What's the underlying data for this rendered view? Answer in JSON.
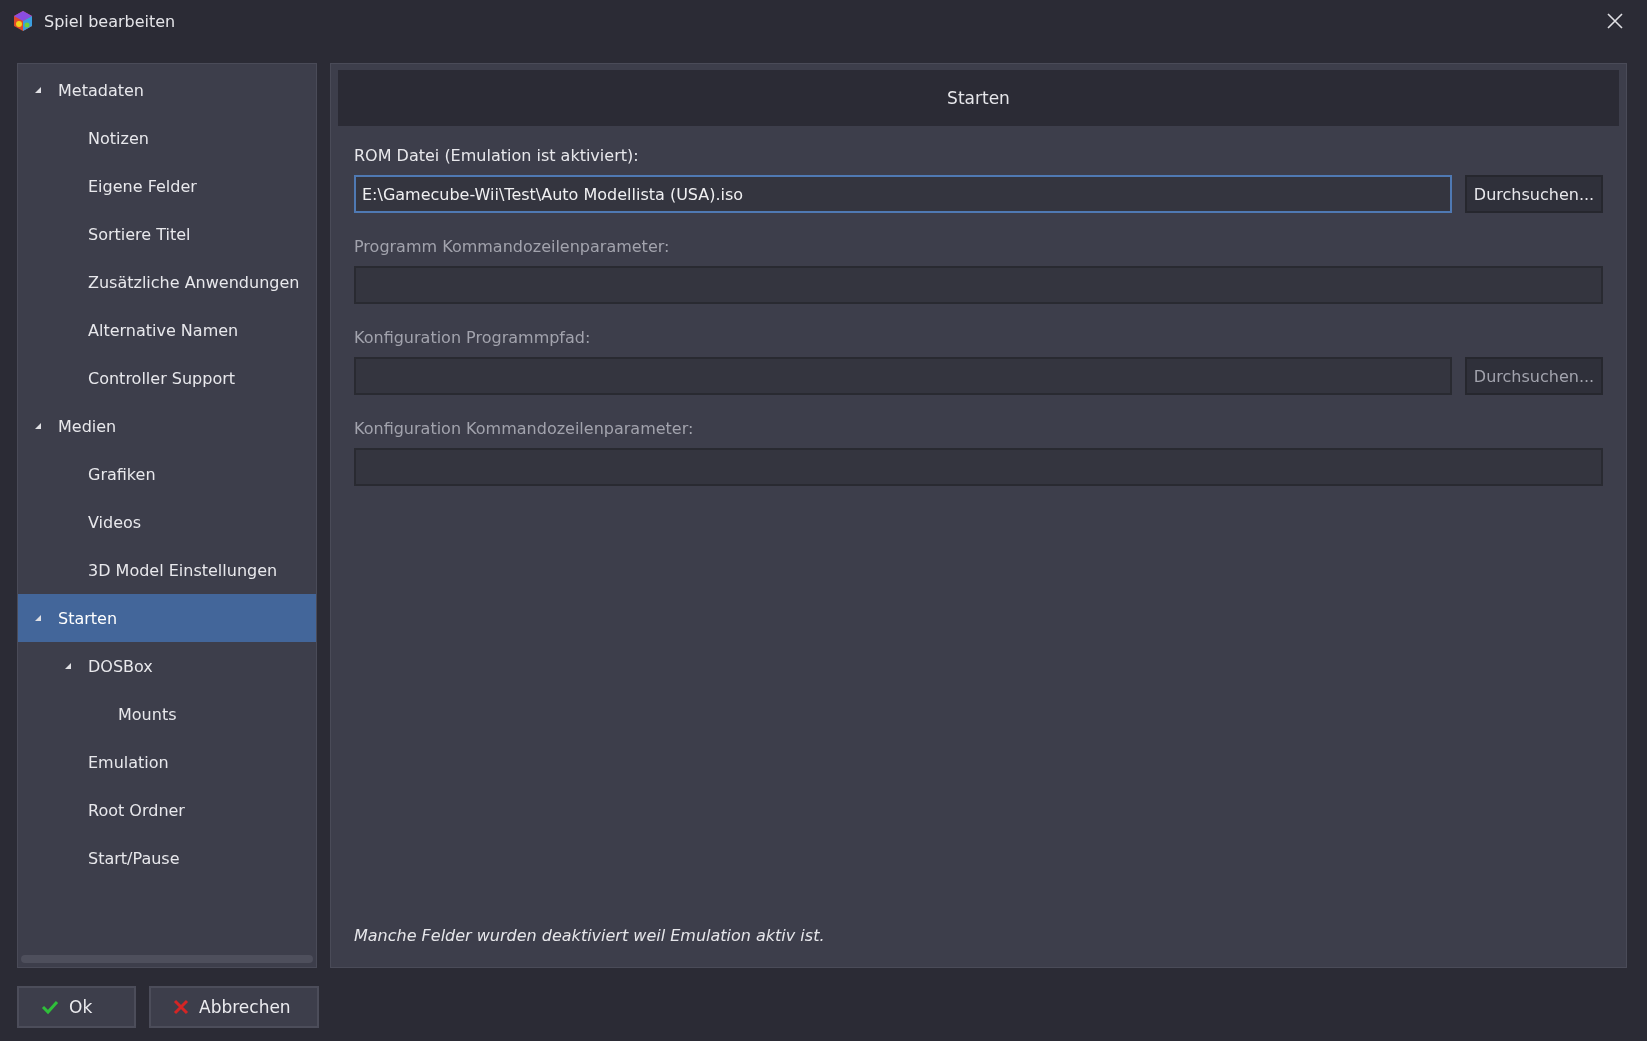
{
  "window": {
    "title": "Spiel bearbeiten"
  },
  "tree": [
    {
      "label": "Metadaten",
      "expanded": true,
      "selected": false,
      "children": [
        {
          "label": "Notizen",
          "selected": false
        },
        {
          "label": "Eigene Felder",
          "selected": false
        },
        {
          "label": "Sortiere Titel",
          "selected": false
        },
        {
          "label": "Zusätzliche Anwendungen",
          "selected": false
        },
        {
          "label": "Alternative Namen",
          "selected": false
        },
        {
          "label": "Controller Support",
          "selected": false
        }
      ]
    },
    {
      "label": "Medien",
      "expanded": true,
      "selected": false,
      "children": [
        {
          "label": "Grafiken",
          "selected": false
        },
        {
          "label": "Videos",
          "selected": false
        },
        {
          "label": "3D Model Einstellungen",
          "selected": false
        }
      ]
    },
    {
      "label": "Starten",
      "expanded": true,
      "selected": true,
      "children": [
        {
          "label": "DOSBox",
          "expanded": true,
          "selected": false,
          "children": [
            {
              "label": "Mounts",
              "selected": false
            }
          ]
        },
        {
          "label": "Emulation",
          "selected": false
        },
        {
          "label": "Root Ordner",
          "selected": false
        },
        {
          "label": "Start/Pause",
          "selected": false
        }
      ]
    }
  ],
  "panel": {
    "title": "Starten",
    "fields": [
      {
        "label": "ROM Datei (Emulation ist aktiviert):",
        "value": "E:\\Gamecube-Wii\\Test\\Auto Modellista (USA).iso",
        "disabled": false,
        "focused": true,
        "button": {
          "label": "Durchsuchen...",
          "disabled": false
        }
      },
      {
        "label": "Programm Kommandozeilenparameter:",
        "disabled": true,
        "focused": false
      },
      {
        "label": "Konfiguration Programmpfad:",
        "disabled": true,
        "focused": false,
        "button": {
          "label": "Durchsuchen...",
          "disabled": true
        }
      },
      {
        "label": "Konfiguration Kommandozeilenparameter:",
        "disabled": true,
        "focused": false
      }
    ],
    "note": "Manche Felder wurden deaktiviert weil Emulation aktiv ist."
  },
  "buttons": [
    {
      "label": "Ok",
      "kind": "ok"
    },
    {
      "label": "Abbrechen",
      "kind": "cancel"
    }
  ]
}
